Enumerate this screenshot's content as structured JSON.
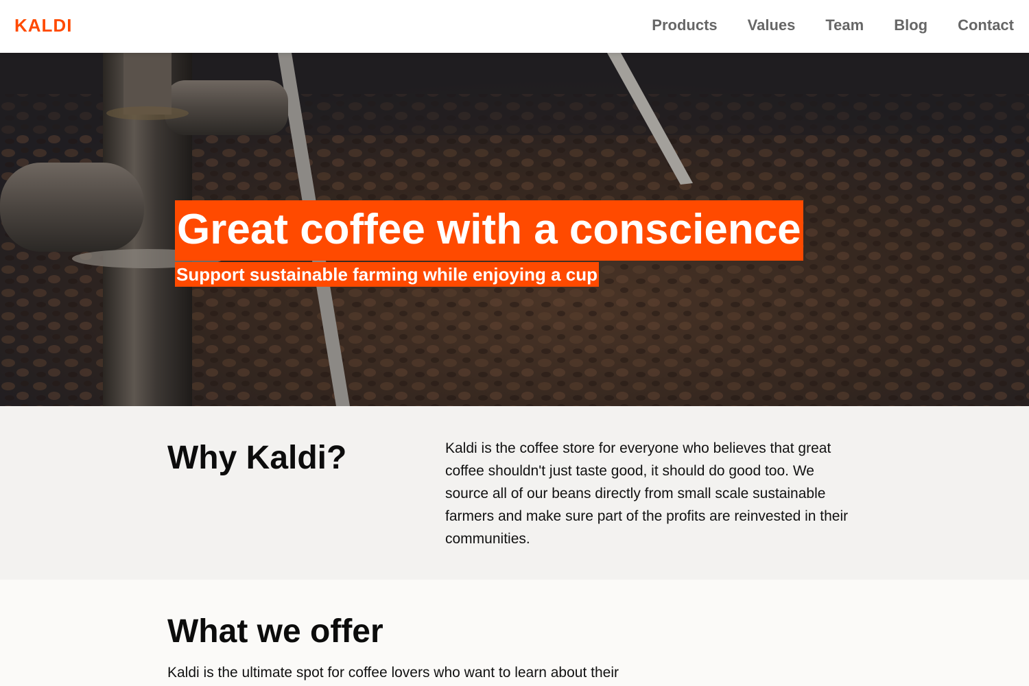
{
  "brand": {
    "name": "KALDI",
    "accent_color": "#ff4a00"
  },
  "nav": {
    "links": [
      {
        "label": "Products"
      },
      {
        "label": "Values"
      },
      {
        "label": "Team"
      },
      {
        "label": "Blog"
      },
      {
        "label": "Contact"
      }
    ]
  },
  "hero": {
    "title": "Great coffee with a conscience",
    "subtitle": "Support sustainable farming while enjoying a cup",
    "image": "coffee-roaster-beans"
  },
  "why": {
    "heading": "Why Kaldi?",
    "text": "Kaldi is the coffee store for everyone who believes that great coffee shouldn't just taste good, it should do good too. We source all of our beans directly from small scale sustainable farmers and make sure part of the profits are reinvested in their communities."
  },
  "offer": {
    "heading": "What we offer",
    "text": "Kaldi is the ultimate spot for coffee lovers who want to learn about their"
  }
}
